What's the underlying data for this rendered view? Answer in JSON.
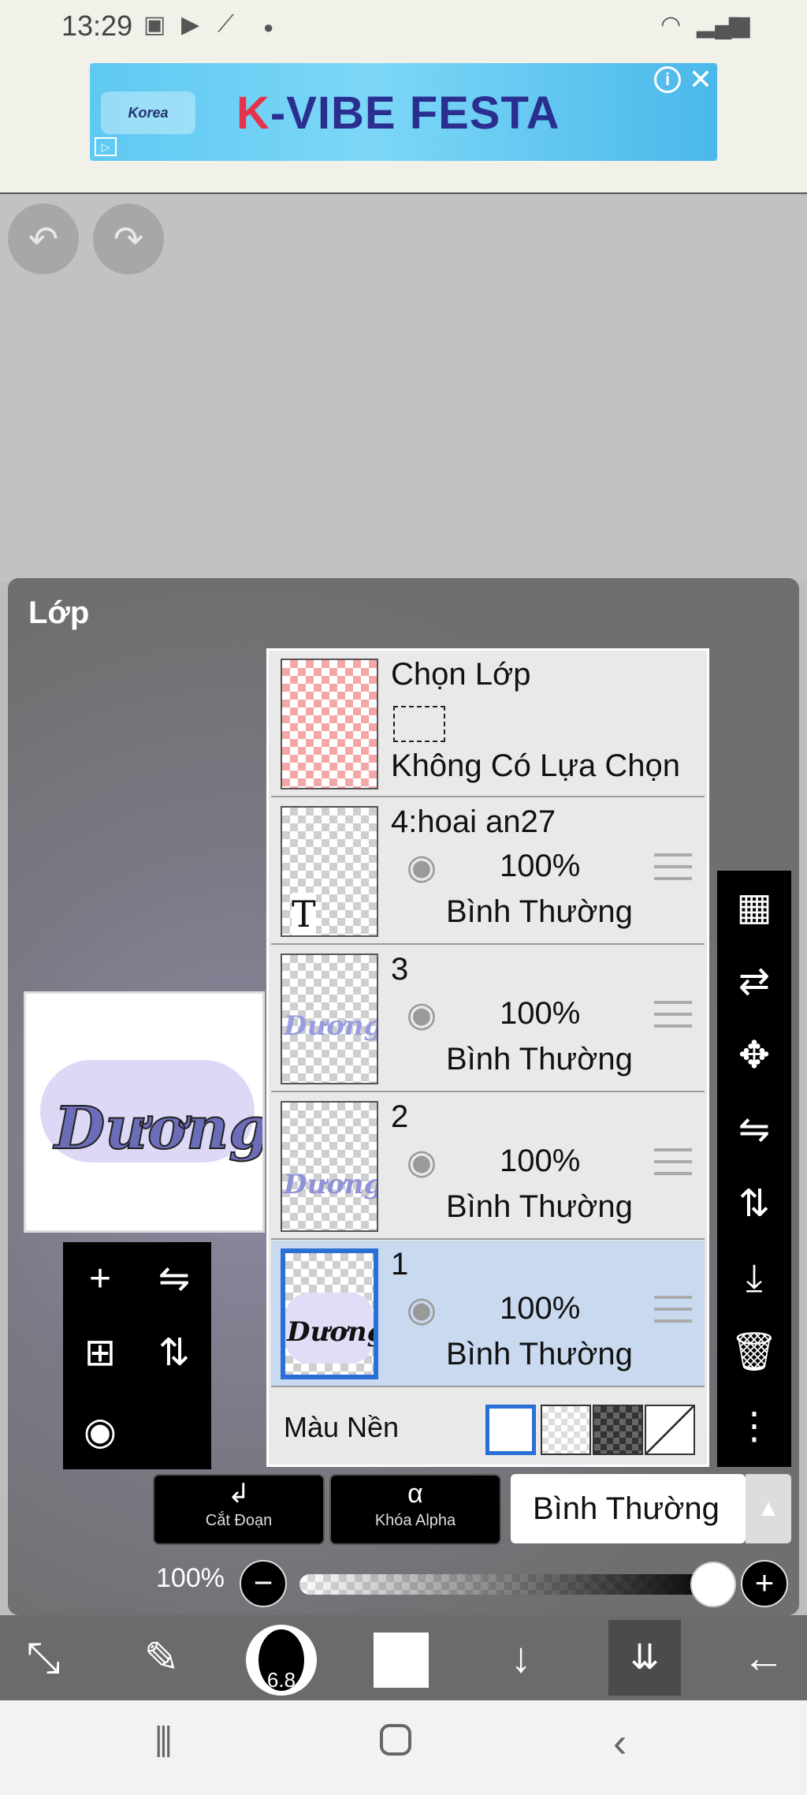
{
  "status_bar": {
    "time": "13:29",
    "icons": [
      "image-icon",
      "play-store-icon",
      "magic-wand-icon",
      "dot-icon",
      "wifi-icon",
      "signal-icon",
      "battery-icon"
    ]
  },
  "ad": {
    "title_k": "K",
    "title_rest": "-VIBE FESTA",
    "logo_text": "Korea",
    "info": "i",
    "close": "✕",
    "adchoice": "▷"
  },
  "canvas": {
    "undo_icon": "↶",
    "redo_icon": "↷"
  },
  "layers_panel": {
    "title": "Lớp",
    "selection_layer": {
      "title": "Chọn Lớp",
      "status": "Không Có Lựa Chọn"
    },
    "layers": [
      {
        "name": "4:hoai an27",
        "opacity": "100%",
        "blend": "Bình Thường",
        "thumb_text": "T"
      },
      {
        "name": "3",
        "opacity": "100%",
        "blend": "Bình Thường",
        "thumb_text": "Dương"
      },
      {
        "name": "2",
        "opacity": "100%",
        "blend": "Bình Thường",
        "thumb_text": "Dương"
      },
      {
        "name": "1",
        "opacity": "100%",
        "blend": "Bình Thường",
        "thumb_text": "Dương"
      }
    ],
    "background_label": "Màu Nền",
    "preview_text": "Dương"
  },
  "controls": {
    "clip_label": "Cắt Đoạn",
    "alpha_lock_label": "Khóa Alpha",
    "blend_mode": "Bình Thường",
    "opacity_label": "100%",
    "opacity_value": 1.0,
    "minus": "−",
    "plus": "+"
  },
  "bottom_toolbar": {
    "brush_size": "6.8"
  },
  "colors": {
    "accent": "#2a6fd6",
    "panel": "#6f6f6f",
    "selected_row": "#c9d9ef"
  }
}
